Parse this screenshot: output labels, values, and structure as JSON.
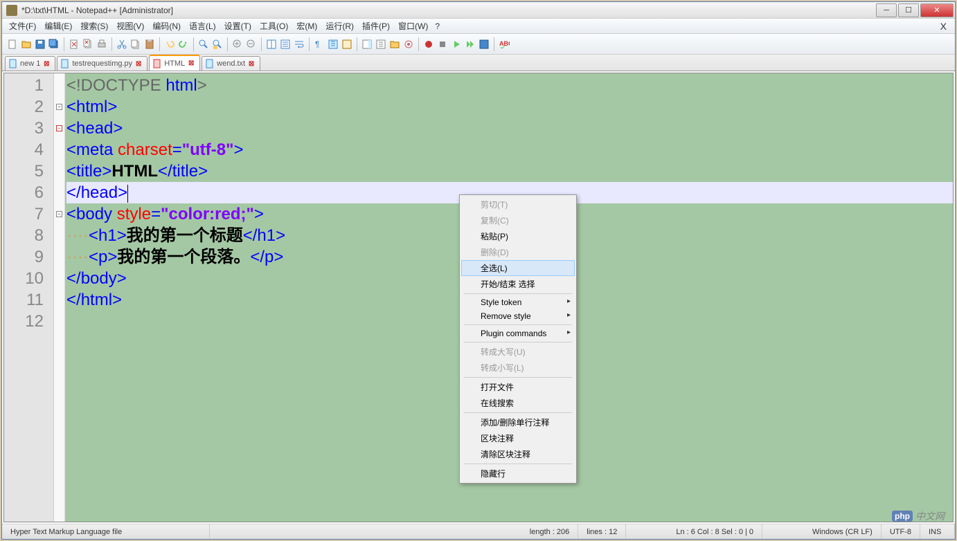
{
  "title": "*D:\\txt\\HTML - Notepad++ [Administrator]",
  "menu": {
    "file": "文件(F)",
    "edit": "编辑(E)",
    "search": "搜索(S)",
    "view": "视图(V)",
    "encode": "编码(N)",
    "language": "语言(L)",
    "settings": "设置(T)",
    "tools": "工具(O)",
    "macro": "宏(M)",
    "run": "运行(R)",
    "plugins": "插件(P)",
    "window": "窗口(W)",
    "help": "?"
  },
  "tabs": [
    {
      "label": "new 1",
      "active": false
    },
    {
      "label": "testrequestimg.py",
      "active": false
    },
    {
      "label": "HTML",
      "active": true
    },
    {
      "label": "wend.txt",
      "active": false
    }
  ],
  "code": {
    "lines": [
      "1",
      "2",
      "3",
      "4",
      "5",
      "6",
      "7",
      "8",
      "9",
      "10",
      "11",
      "12"
    ],
    "l1_a": "<!DOCTYPE ",
    "l1_b": "html",
    "l1_c": ">",
    "l2_a": "<",
    "l2_b": "html",
    "l2_c": ">",
    "l3_a": "<",
    "l3_b": "head",
    "l3_c": ">",
    "l4_a": "<",
    "l4_b": "meta ",
    "l4_c": "charset",
    "l4_d": "=",
    "l4_e": "\"utf-8\"",
    "l4_f": ">",
    "l5_a": "<",
    "l5_b": "title",
    "l5_c": ">",
    "l5_d": "HTML",
    "l5_e": "</",
    "l5_f": "title",
    "l5_g": ">",
    "l6_a": "</",
    "l6_b": "head",
    "l6_c": ">",
    "l7_a": "<",
    "l7_b": "body ",
    "l7_c": "style",
    "l7_d": "=",
    "l7_e": "\"color:red;\"",
    "l7_f": ">",
    "l8_ws": "····",
    "l8_a": "<",
    "l8_b": "h1",
    "l8_c": ">",
    "l8_d": "我的第一个标题",
    "l8_e": "</",
    "l8_f": "h1",
    "l8_g": ">",
    "l9_ws": "····",
    "l9_a": "<",
    "l9_b": "p",
    "l9_c": ">",
    "l9_d": "我的第一个段落。",
    "l9_e": "</",
    "l9_f": "p",
    "l9_g": ">",
    "l10_a": "</",
    "l10_b": "body",
    "l10_c": ">",
    "l11_a": "</",
    "l11_b": "html",
    "l11_c": ">"
  },
  "context_menu": {
    "cut": "剪切(T)",
    "copy": "复制(C)",
    "paste": "粘贴(P)",
    "delete": "删除(D)",
    "select_all": "全选(L)",
    "begin_end_select": "开始/结束 选择",
    "style_token": "Style token",
    "remove_style": "Remove style",
    "plugin_commands": "Plugin commands",
    "uppercase": "转成大写(U)",
    "lowercase": "转成小写(L)",
    "open_file": "打开文件",
    "online_search": "在线搜索",
    "toggle_comment": "添加/删除单行注释",
    "block_comment": "区块注释",
    "clear_block_comment": "清除区块注释",
    "hide_lines": "隐藏行"
  },
  "status": {
    "filetype": "Hyper Text Markup Language file",
    "length": "length : 206",
    "lines": "lines : 12",
    "position": "Ln : 6    Col : 8    Sel : 0 | 0",
    "eol": "Windows (CR LF)",
    "encoding": "UTF-8",
    "mode": "INS"
  },
  "watermark": {
    "php": "php",
    "text": "中文网"
  }
}
